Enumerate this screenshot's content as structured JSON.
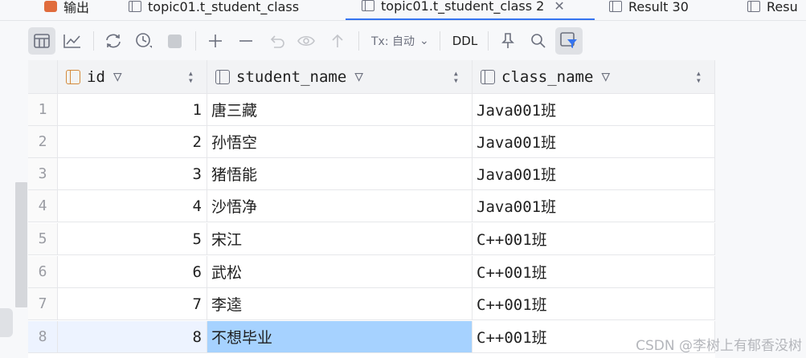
{
  "tabs": [
    {
      "label": "输出",
      "icon": "output-icon"
    },
    {
      "label": "topic01.t_student_class",
      "icon": "table-icon"
    },
    {
      "label": "topic01.t_student_class 2",
      "icon": "table-icon",
      "active": true,
      "close": "✕"
    },
    {
      "label": "Result 30",
      "icon": "table-icon"
    },
    {
      "label": "Resu",
      "icon": "table-icon"
    }
  ],
  "toolbar": {
    "tx_label": "Tx: 自动",
    "ddl_label": "DDL",
    "icons": [
      "table-view-icon",
      "chart-view-icon",
      "refresh-icon",
      "history-icon",
      "stop-icon",
      "add-row-icon",
      "delete-row-icon",
      "revert-icon",
      "preview-icon",
      "submit-icon",
      "pin-icon",
      "search-icon",
      "filter-toggle-icon"
    ]
  },
  "columns": [
    {
      "name": "id",
      "icon": "primary-key-column-icon"
    },
    {
      "name": "student_name",
      "icon": "column-icon"
    },
    {
      "name": "class_name",
      "icon": "column-icon"
    }
  ],
  "rows": [
    {
      "n": "1",
      "id": "1",
      "student_name": "唐三藏",
      "class_name": "Java001班"
    },
    {
      "n": "2",
      "id": "2",
      "student_name": "孙悟空",
      "class_name": "Java001班"
    },
    {
      "n": "3",
      "id": "3",
      "student_name": "猪悟能",
      "class_name": "Java001班"
    },
    {
      "n": "4",
      "id": "4",
      "student_name": "沙悟净",
      "class_name": "Java001班"
    },
    {
      "n": "5",
      "id": "5",
      "student_name": "宋江",
      "class_name": "C++001班"
    },
    {
      "n": "6",
      "id": "6",
      "student_name": "武松",
      "class_name": "C++001班"
    },
    {
      "n": "7",
      "id": "7",
      "student_name": "李逵",
      "class_name": "C++001班"
    },
    {
      "n": "8",
      "id": "8",
      "student_name": "不想毕业",
      "class_name": "C++001班"
    }
  ],
  "selected_row": 8,
  "watermark": "CSDN @李树上有郁香没树",
  "colors": {
    "accent": "#3574f0",
    "selection": "#a6d2ff",
    "current_row": "#edf3ff"
  }
}
